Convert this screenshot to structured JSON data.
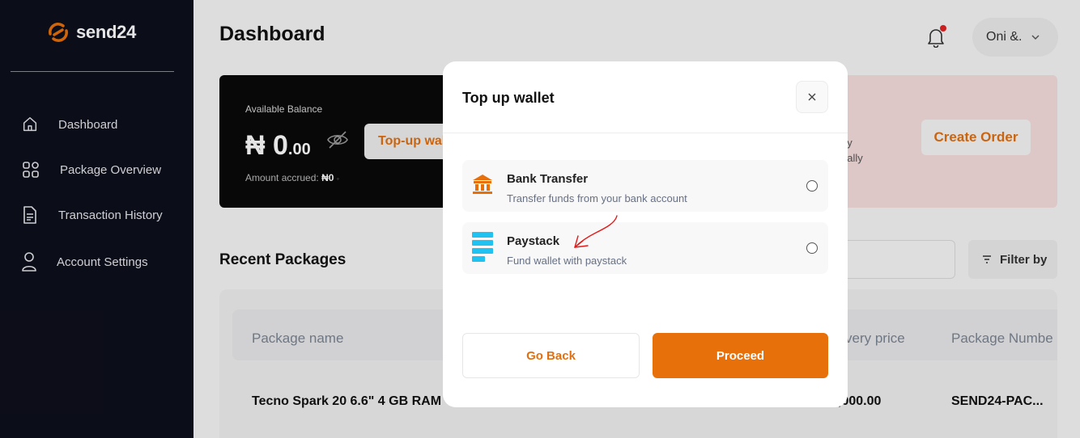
{
  "brand": {
    "name": "send24",
    "accent": "#e8700a"
  },
  "sidebar": {
    "items": [
      {
        "label": "Dashboard",
        "icon": "home-icon"
      },
      {
        "label": "Package Overview",
        "icon": "grid-icon"
      },
      {
        "label": "Transaction History",
        "icon": "document-icon"
      },
      {
        "label": "Account Settings",
        "icon": "user-icon"
      }
    ]
  },
  "header": {
    "title": "Dashboard",
    "user_name": "Oni &."
  },
  "balance": {
    "label": "Available Balance",
    "amount_main": "₦ 0",
    "amount_decimal": ".00",
    "accrued_label": "Amount accrued:",
    "accrued_value": "₦0",
    "topup_label": "Top-up wallet"
  },
  "order_card": {
    "line1": "by",
    "line2": "ually",
    "create_label": "Create Order"
  },
  "recent": {
    "title": "Recent Packages",
    "filter_label": "Filter by",
    "columns": [
      "Package name",
      "very price",
      "Package Numbe"
    ],
    "rows": [
      {
        "name": "Tecno Spark 20 6.6\" 4 GB RAM",
        "price": ",000.00",
        "number": "SEND24-PAC..."
      }
    ]
  },
  "modal": {
    "title": "Top up wallet",
    "options": [
      {
        "title": "Bank Transfer",
        "subtitle": "Transfer funds from your bank account",
        "icon": "bank-icon"
      },
      {
        "title": "Paystack",
        "subtitle": "Fund wallet with paystack",
        "icon": "paystack-icon"
      }
    ],
    "back_label": "Go Back",
    "proceed_label": "Proceed"
  }
}
